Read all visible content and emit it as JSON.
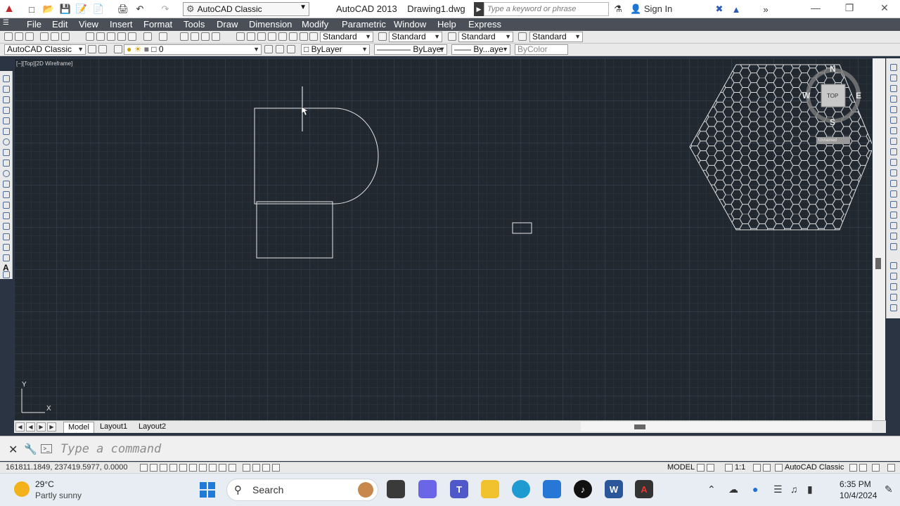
{
  "window": {
    "app_title": "AutoCAD 2013",
    "doc_title": "Drawing1.dwg",
    "workspace": "AutoCAD Classic",
    "search_placeholder": "Type a keyword or phrase",
    "signin": "Sign In"
  },
  "menu": [
    "File",
    "Edit",
    "View",
    "Insert",
    "Format",
    "Tools",
    "Draw",
    "Dimension",
    "Modify",
    "Parametric",
    "Window",
    "Help",
    "Express"
  ],
  "styles": {
    "text_style": "Standard",
    "dim_style": "Standard",
    "table_style": "Standard",
    "mleader_style": "Standard"
  },
  "layers": {
    "workspace": "AutoCAD Classic",
    "current_layer": "0",
    "color": "ByLayer",
    "linetype": "ByLayer",
    "lineweight": "By...aye",
    "plot_style": "ByColor"
  },
  "viewport": {
    "label": "[−][Top][2D Wireframe]"
  },
  "viewcube": {
    "north": "N",
    "south": "S",
    "east": "E",
    "west": "W",
    "face": "TOP",
    "wcs": "Unnamed"
  },
  "ucs": {
    "x": "X",
    "y": "Y"
  },
  "tabs": [
    "Model",
    "Layout1",
    "Layout2"
  ],
  "command": {
    "placeholder": "Type a command"
  },
  "status": {
    "coords": "161811.1849, 237419.5977, 0.0000",
    "model": "MODEL",
    "scale": "1:1",
    "workspace": "AutoCAD Classic"
  },
  "taskbar": {
    "temperature": "29°C",
    "weather": "Partly sunny",
    "search": "Search",
    "time": "6:35 PM",
    "date": "10/4/2024"
  },
  "colors": {
    "canvas": "#212830",
    "menubar": "#4a4f58",
    "entity": "#e6e6e6"
  }
}
